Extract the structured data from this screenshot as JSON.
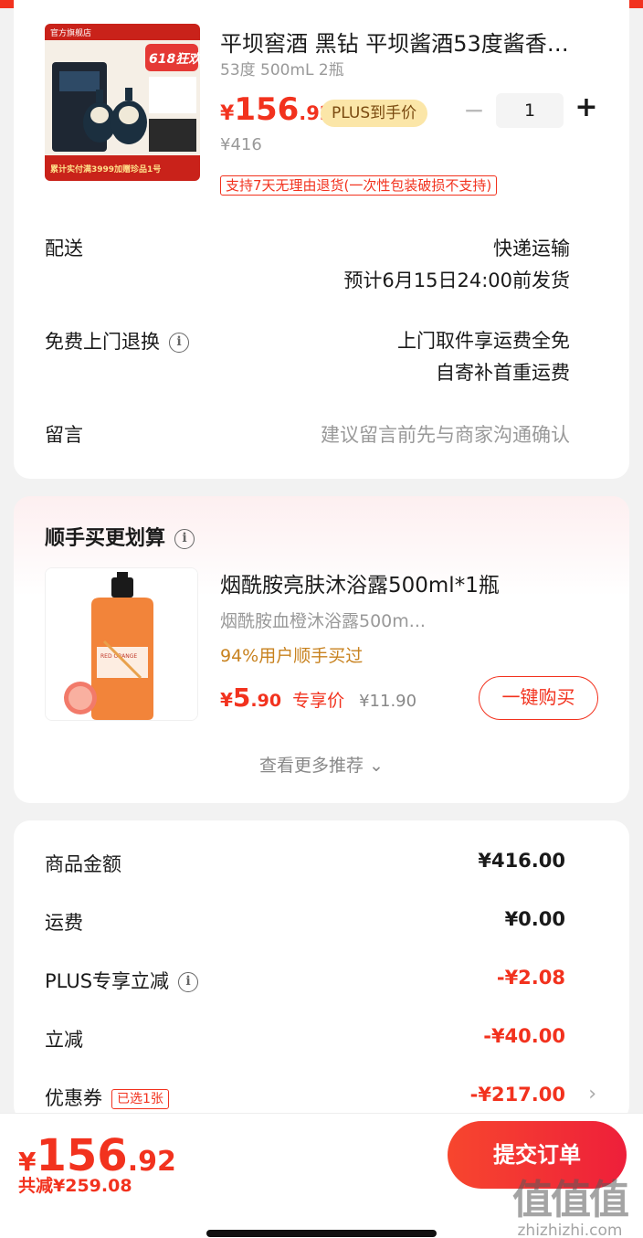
{
  "product": {
    "title": "平坝窖酒 黑钻 平坝酱酒53度酱香…",
    "spec": "53度 500mL 2瓶",
    "price_yen": "¥",
    "price_int": "156",
    "price_dec": ".92",
    "plus_badge": "PLUS到手价",
    "orig_price": "¥416",
    "quantity": "1",
    "minus": "−",
    "plus": "+",
    "return_tag": "支持7天无理由退货(一次性包装破损不支持)",
    "image_text": {
      "store": "官方旗舰店",
      "promo": "618狂欢",
      "banner": "累计实付满3999加赠珍品1号"
    }
  },
  "delivery": {
    "label": "配送",
    "method": "快递运输",
    "eta": "预计6月15日24:00前发货"
  },
  "free_return": {
    "label": "免费上门退换",
    "line1": "上门取件享运费全免",
    "line2": "自寄补首重运费"
  },
  "message": {
    "label": "留言",
    "placeholder": "建议留言前先与商家沟通确认"
  },
  "recommend": {
    "title": "顺手买更划算",
    "name": "烟酰胺亮肤沐浴露500ml*1瓶",
    "sub": "烟酰胺血橙沐浴露500m...",
    "pct": "94%用户顺手买过",
    "price_yen": "¥",
    "price_int": "5",
    "price_dec": ".90",
    "price_tag": "专享价",
    "old_price": "¥11.90",
    "buy_label": "一键购买",
    "more_label": "查看更多推荐 ⌄",
    "image_text": "RED ORANGE"
  },
  "summary": {
    "goods_label": "商品金额",
    "goods_value": "¥416.00",
    "shipping_label": "运费",
    "shipping_value": "¥0.00",
    "plus_label": "PLUS专享立减",
    "plus_value": "-¥2.08",
    "discount_label": "立减",
    "discount_value": "-¥40.00",
    "coupon_label": "优惠券",
    "coupon_tag": "已选1张",
    "coupon_value": "-¥217.00"
  },
  "footer": {
    "total_yen": "¥",
    "total_int": "156",
    "total_dec": ".92",
    "saved": "共减¥259.08",
    "submit_label": "提交订单",
    "watermark_big": "值值值",
    "watermark_small": "zhizhizhi.com"
  },
  "colors": {
    "accent": "#f2321e",
    "plus_badge_bg": "#fbe6a8",
    "recommend_pct": "#c8821f"
  }
}
